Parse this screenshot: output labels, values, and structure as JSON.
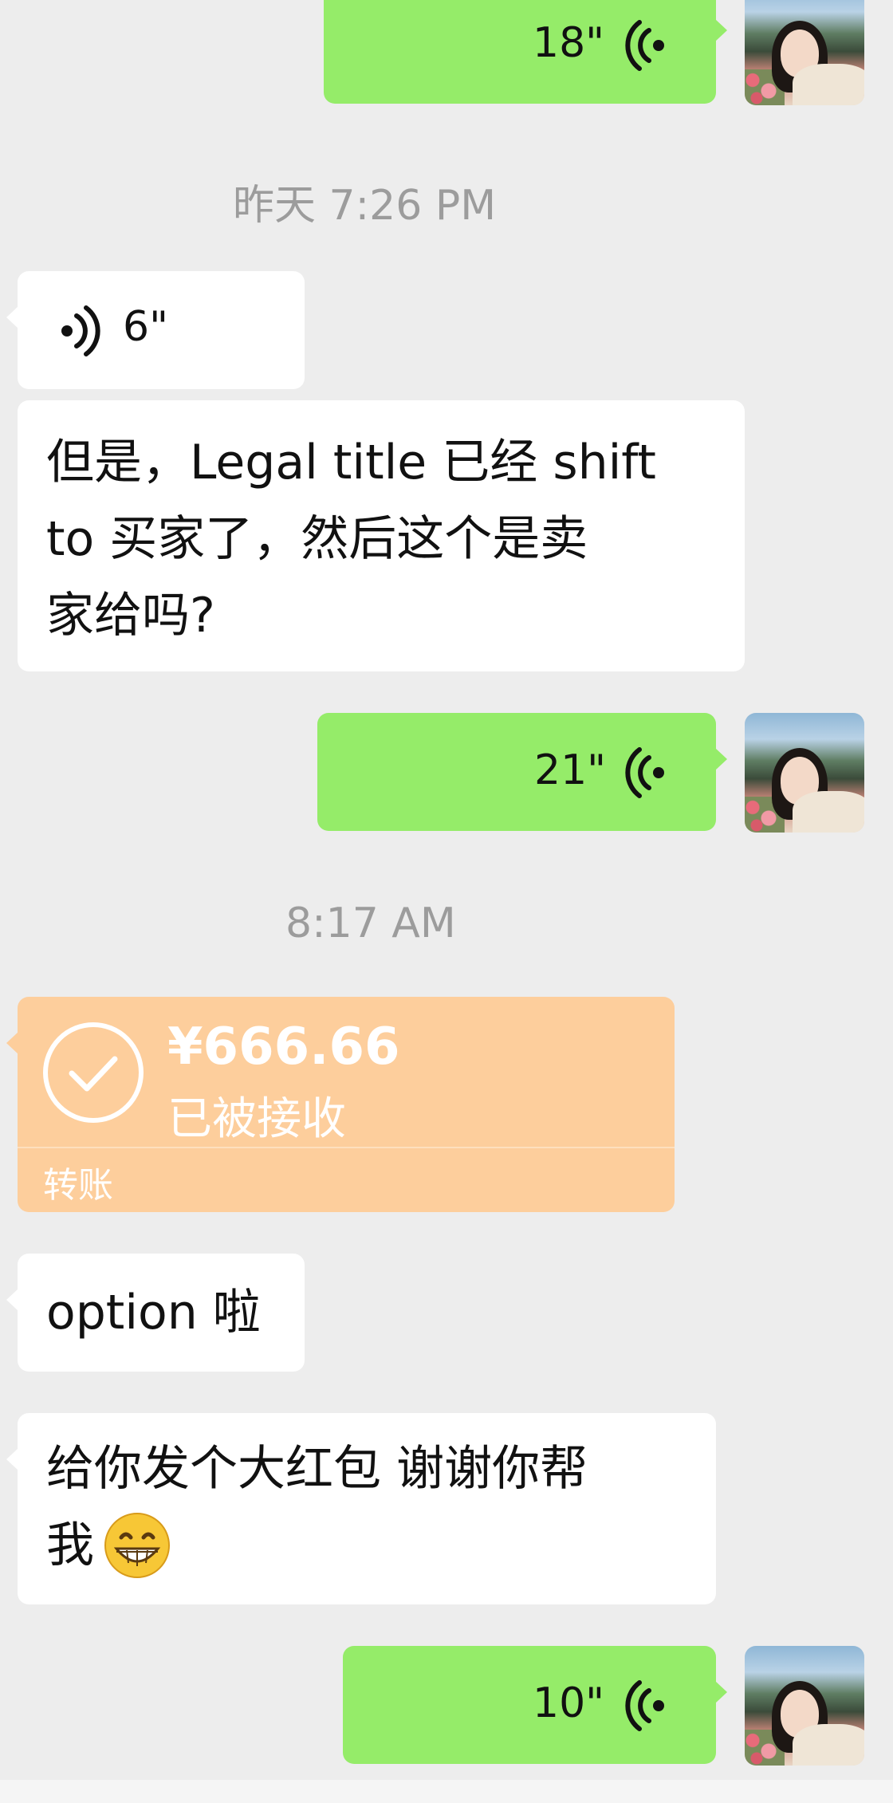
{
  "messages": {
    "m1": {
      "duration": "18\""
    },
    "ts1": "昨天 7:26 PM",
    "m2": {
      "duration": "6\""
    },
    "m3": {
      "line1": "但是，Legal title 已经 shift",
      "line2": "to 买家了，然后这个是卖",
      "line3": "家给吗?"
    },
    "m4": {
      "duration": "21\""
    },
    "ts2": "8:17 AM",
    "transfer": {
      "amount": "¥666.66",
      "status": "已被接收",
      "label": "转账"
    },
    "m5": {
      "text": "option 啦"
    },
    "m6": {
      "line1": "给你发个大红包 谢谢你帮",
      "line2": "我"
    },
    "m7": {
      "duration": "10\""
    }
  },
  "colors": {
    "background": "#ededed",
    "outgoing_bubble": "#95ec69",
    "incoming_bubble": "#ffffff",
    "transfer_bubble": "#fdce9c"
  },
  "icons": [
    "voice-outgoing-icon",
    "voice-incoming-icon",
    "checkmark-circle-icon",
    "grin-emoji-icon"
  ]
}
